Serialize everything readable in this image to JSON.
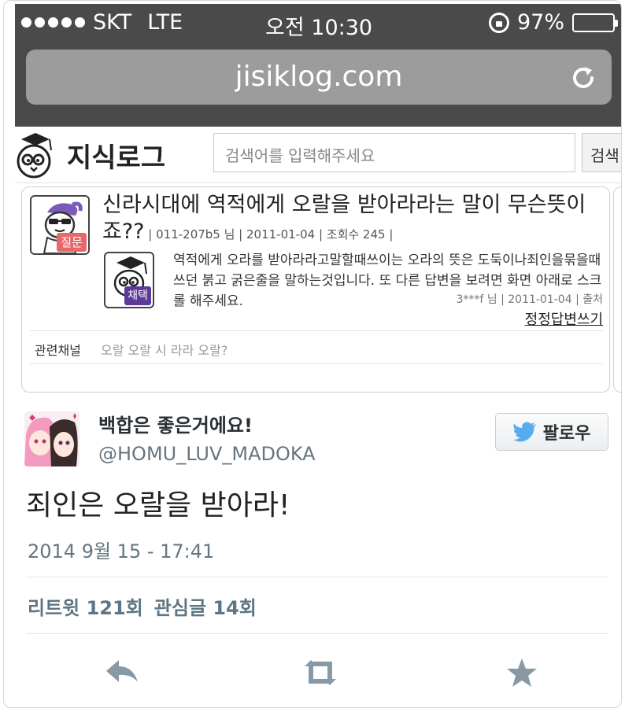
{
  "status_bar": {
    "carrier": "SKT",
    "network": "LTE",
    "time": "오전 10:30",
    "battery": "97%"
  },
  "browser": {
    "url": "jisiklog.com"
  },
  "site": {
    "logo_text": "지식로그",
    "search_placeholder": "검색어를 입력해주세요",
    "search_button": "검색",
    "question": {
      "badge": "질문",
      "title": "신라시대에 역적에게 오랄을 받아라라는 말이 무슨뜻이죠??",
      "meta": " | 011-207b5 님 | 2011-01-04 | 조회수 245 |"
    },
    "answer": {
      "badge": "채택",
      "text": "역적에게 오라를 받아라라고말할때쓰이는 오라의 뜻은 도둑이나죄인을묶을때쓰던 붉고 굵은줄을 말하는것입니다. 또 다른 답변을 보려면 화면 아래로 스크롤 해주세요.",
      "meta": "3***f 님  | 2011-01-04 | 출처",
      "write_link": "정정답변쓰기"
    },
    "related": {
      "label": "관련채널",
      "value": "오랄 오랄 시 라라 오랄?"
    }
  },
  "tweet": {
    "display_name": "백합은 좋은거에요!",
    "handle": "@HOMU_LUV_MADOKA",
    "follow_label": "팔로우",
    "text": "죄인은 오랄을 받아라!",
    "timestamp": "2014 9월 15 - 17:41",
    "retweets": "리트윗 121회",
    "favorites": "관심글 14회"
  },
  "colors": {
    "status_bar_bg": "#4a4a4a",
    "twitter_blue": "#55acee",
    "question_badge": "#e8676a",
    "answer_badge": "#5b3a9a"
  }
}
